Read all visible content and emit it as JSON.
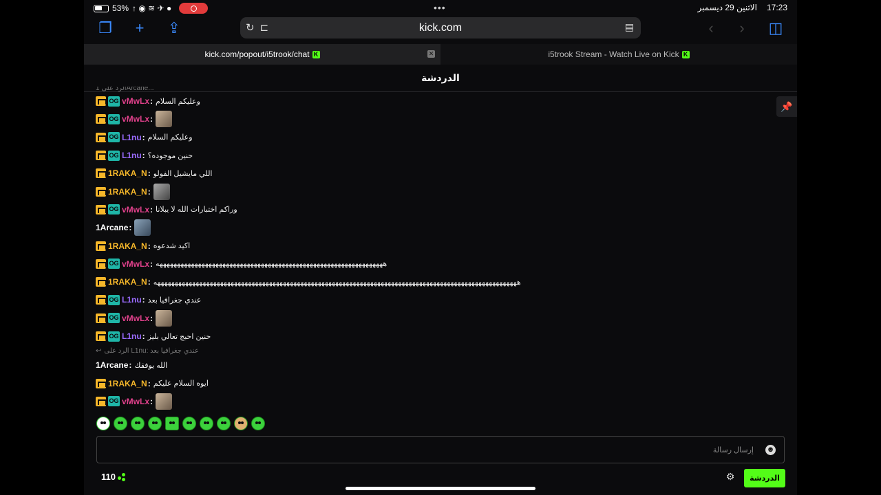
{
  "status_bar": {
    "battery": "53%",
    "time": "17:23",
    "date": "الاثنين 29 ديسمبر",
    "dots": "•••"
  },
  "browser": {
    "url": "kick.com",
    "tabs": [
      {
        "label": "kick.com/popout/i5trook/chat",
        "active": true
      },
      {
        "label": "i5trook Stream - Watch Live on Kick",
        "active": false
      }
    ]
  },
  "chat": {
    "title": "الدردشة",
    "partial_top": "الرد على 1Arcane...",
    "messages": [
      {
        "user": "vMwLx",
        "color": "#e2418c",
        "badges": [
          "crown",
          "og"
        ],
        "text": "وعليكم السلام",
        "emote": null
      },
      {
        "user": "vMwLx",
        "color": "#e2418c",
        "badges": [
          "crown",
          "og"
        ],
        "text": "",
        "emote": "brown"
      },
      {
        "user": "L1nu",
        "color": "#9b6bff",
        "badges": [
          "crown",
          "og"
        ],
        "text": "وعليكم السلام",
        "emote": null
      },
      {
        "user": "L1nu",
        "color": "#9b6bff",
        "badges": [
          "crown",
          "og"
        ],
        "text": "حنين موجوده؟",
        "emote": null
      },
      {
        "user": "1RAKA_N",
        "color": "#f6b72a",
        "badges": [
          "crown"
        ],
        "text": "اللي مايشيل الفولو",
        "emote": null
      },
      {
        "user": "1RAKA_N",
        "color": "#f6b72a",
        "badges": [
          "crown"
        ],
        "text": "",
        "emote": "dark"
      },
      {
        "user": "vMwLx",
        "color": "#e2418c",
        "badges": [
          "crown",
          "og"
        ],
        "text": "وراكم اختبارات الله لا يبلانا",
        "emote": null
      },
      {
        "user": "1Arcane",
        "color": "#ffffff",
        "badges": [],
        "text": "",
        "emote": "blue"
      },
      {
        "user": "1RAKA_N",
        "color": "#f6b72a",
        "badges": [
          "crown"
        ],
        "text": "اكيد شدعوه",
        "emote": null
      },
      {
        "user": "vMwLx",
        "color": "#e2418c",
        "badges": [
          "crown",
          "og"
        ],
        "text": "هههههههههههههههههههههههههههههههههههههههههههههههههههههههههههههههههه",
        "emote": null
      },
      {
        "user": "1RAKA_N",
        "color": "#f6b72a",
        "badges": [
          "crown"
        ],
        "text": "ههههههههههههههههههههههههههههههههههههههههههههههههههههههههههههههههههههههههههههههههههههههههههههههههههههههههه",
        "emote": null
      },
      {
        "user": "L1nu",
        "color": "#9b6bff",
        "badges": [
          "crown",
          "og"
        ],
        "text": "عندي جغرافيا بعد",
        "emote": null
      },
      {
        "user": "vMwLx",
        "color": "#e2418c",
        "badges": [
          "crown",
          "og"
        ],
        "text": "",
        "emote": "brown"
      },
      {
        "user": "L1nu",
        "color": "#9b6bff",
        "badges": [
          "crown",
          "og"
        ],
        "text": "حنين احبج تعالي بليز",
        "emote": null
      }
    ],
    "reply": {
      "label": "الرد على L1nu: عندي جغرافيا بعد"
    },
    "messages_after": [
      {
        "user": "1Arcane",
        "color": "#ffffff",
        "badges": [],
        "text": "الله يوفقك",
        "emote": null
      },
      {
        "user": "1RAKA_N",
        "color": "#f6b72a",
        "badges": [
          "crown"
        ],
        "text": "ايوه السلام عليكم",
        "emote": null
      },
      {
        "user": "vMwLx",
        "color": "#e2418c",
        "badges": [
          "crown",
          "og"
        ],
        "text": "",
        "emote": "brown"
      }
    ],
    "input_placeholder": "إرسال رسالة",
    "viewers": "110",
    "send_button": "الدردشة"
  },
  "badge_og_label": "OG",
  "kick_logo_letter": "K"
}
